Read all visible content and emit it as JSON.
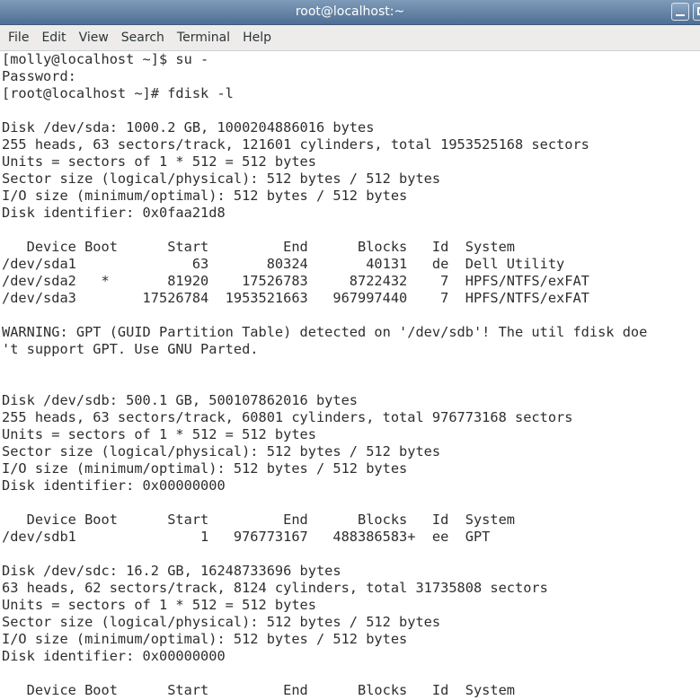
{
  "window": {
    "title": "root@localhost:~"
  },
  "menubar": {
    "items": [
      "File",
      "Edit",
      "View",
      "Search",
      "Terminal",
      "Help"
    ]
  },
  "terminal": {
    "lines": [
      "[molly@localhost ~]$ su -",
      "Password:",
      "[root@localhost ~]# fdisk -l",
      "",
      "Disk /dev/sda: 1000.2 GB, 1000204886016 bytes",
      "255 heads, 63 sectors/track, 121601 cylinders, total 1953525168 sectors",
      "Units = sectors of 1 * 512 = 512 bytes",
      "Sector size (logical/physical): 512 bytes / 512 bytes",
      "I/O size (minimum/optimal): 512 bytes / 512 bytes",
      "Disk identifier: 0x0faa21d8",
      "",
      "   Device Boot      Start         End      Blocks   Id  System",
      "/dev/sda1              63       80324       40131   de  Dell Utility",
      "/dev/sda2   *       81920    17526783     8722432    7  HPFS/NTFS/exFAT",
      "/dev/sda3        17526784  1953521663   967997440    7  HPFS/NTFS/exFAT",
      "",
      "WARNING: GPT (GUID Partition Table) detected on '/dev/sdb'! The util fdisk doe",
      "'t support GPT. Use GNU Parted.",
      "",
      "",
      "Disk /dev/sdb: 500.1 GB, 500107862016 bytes",
      "255 heads, 63 sectors/track, 60801 cylinders, total 976773168 sectors",
      "Units = sectors of 1 * 512 = 512 bytes",
      "Sector size (logical/physical): 512 bytes / 512 bytes",
      "I/O size (minimum/optimal): 512 bytes / 512 bytes",
      "Disk identifier: 0x00000000",
      "",
      "   Device Boot      Start         End      Blocks   Id  System",
      "/dev/sdb1               1   976773167   488386583+  ee  GPT",
      "",
      "Disk /dev/sdc: 16.2 GB, 16248733696 bytes",
      "63 heads, 62 sectors/track, 8124 cylinders, total 31735808 sectors",
      "Units = sectors of 1 * 512 = 512 bytes",
      "Sector size (logical/physical): 512 bytes / 512 bytes",
      "I/O size (minimum/optimal): 512 bytes / 512 bytes",
      "Disk identifier: 0x00000000",
      "",
      "   Device Boot      Start         End      Blocks   Id  System"
    ]
  }
}
